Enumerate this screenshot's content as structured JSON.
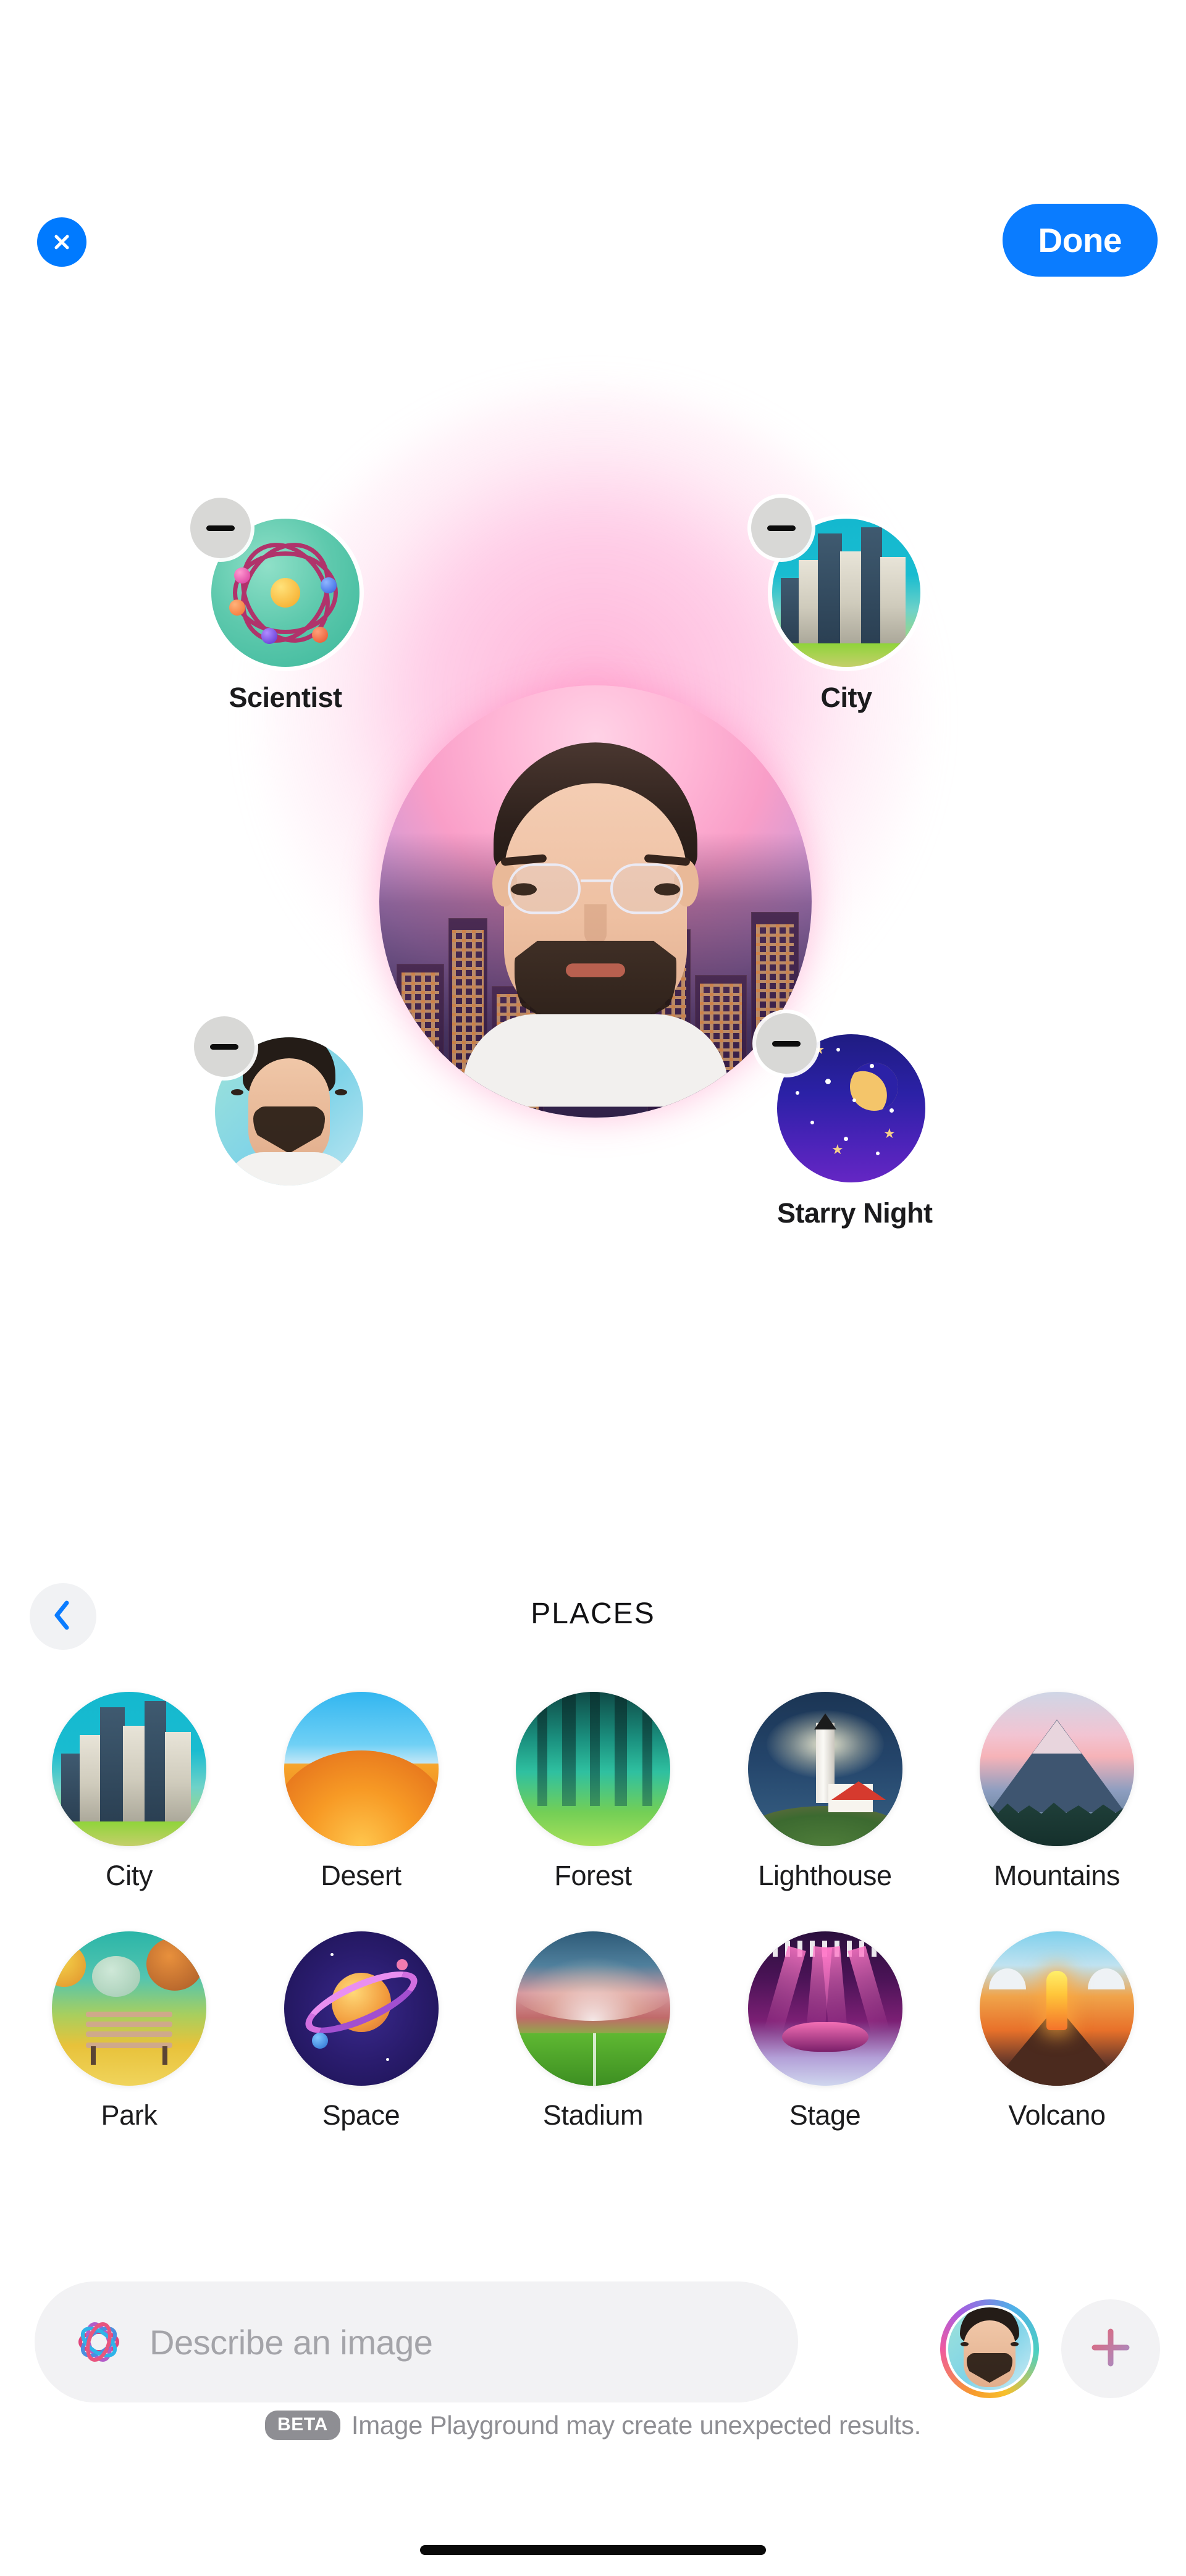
{
  "header": {
    "close_icon": "close-x-icon",
    "done_label": "Done"
  },
  "canvas": {
    "main_image_alt": "generated-portrait",
    "concepts": [
      {
        "label": "Scientist",
        "icon": "atom-icon",
        "remove_icon": "minus-icon"
      },
      {
        "label": "City",
        "icon": "city-skyline-icon",
        "remove_icon": "minus-icon"
      },
      {
        "label": "",
        "icon": "person-photo-icon",
        "remove_icon": "minus-icon"
      },
      {
        "label": "Starry Night",
        "icon": "starry-night-icon",
        "remove_icon": "minus-icon"
      }
    ]
  },
  "category": {
    "back_icon": "chevron-left-icon",
    "title": "PLACES",
    "tiles": [
      {
        "label": "City"
      },
      {
        "label": "Desert"
      },
      {
        "label": "Forest"
      },
      {
        "label": "Lighthouse"
      },
      {
        "label": "Mountains"
      },
      {
        "label": "Park"
      },
      {
        "label": "Space"
      },
      {
        "label": "Stadium"
      },
      {
        "label": "Stage"
      },
      {
        "label": "Volcano"
      }
    ]
  },
  "bottom": {
    "ai_icon": "apple-intelligence-icon",
    "prompt_placeholder": "Describe an image",
    "avatar_alt": "user-avatar",
    "add_icon": "plus-icon",
    "beta_badge": "BETA",
    "disclaimer": "Image Playground may create unexpected results."
  },
  "colors": {
    "accent_blue": "#0a7cff",
    "close_blue": "#007aff",
    "text_primary": "#1c1c1e",
    "text_muted": "#8e8e93",
    "field_bg": "#f2f2f4"
  }
}
